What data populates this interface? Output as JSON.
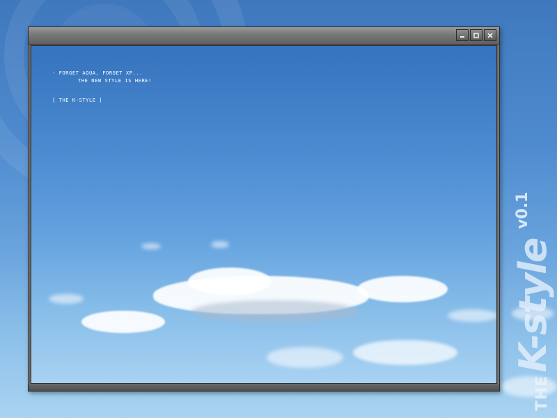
{
  "wallpaper": {
    "brand": {
      "the": "THE",
      "name": "K-style",
      "version": "v0.1"
    }
  },
  "window": {
    "controls": {
      "minimize": "minimize-icon",
      "maximize": "maximize-icon",
      "close": "close-icon"
    },
    "content": {
      "line1": "- FORGET AQUA, FORGET XP...",
      "line2": "THE NEW STYLE IS HERE!",
      "signature": "[ THE K-STYLE ]"
    }
  },
  "colors": {
    "sky_top": "#3573bd",
    "sky_bottom": "#a9d2f2",
    "window_frame": "#636363"
  }
}
